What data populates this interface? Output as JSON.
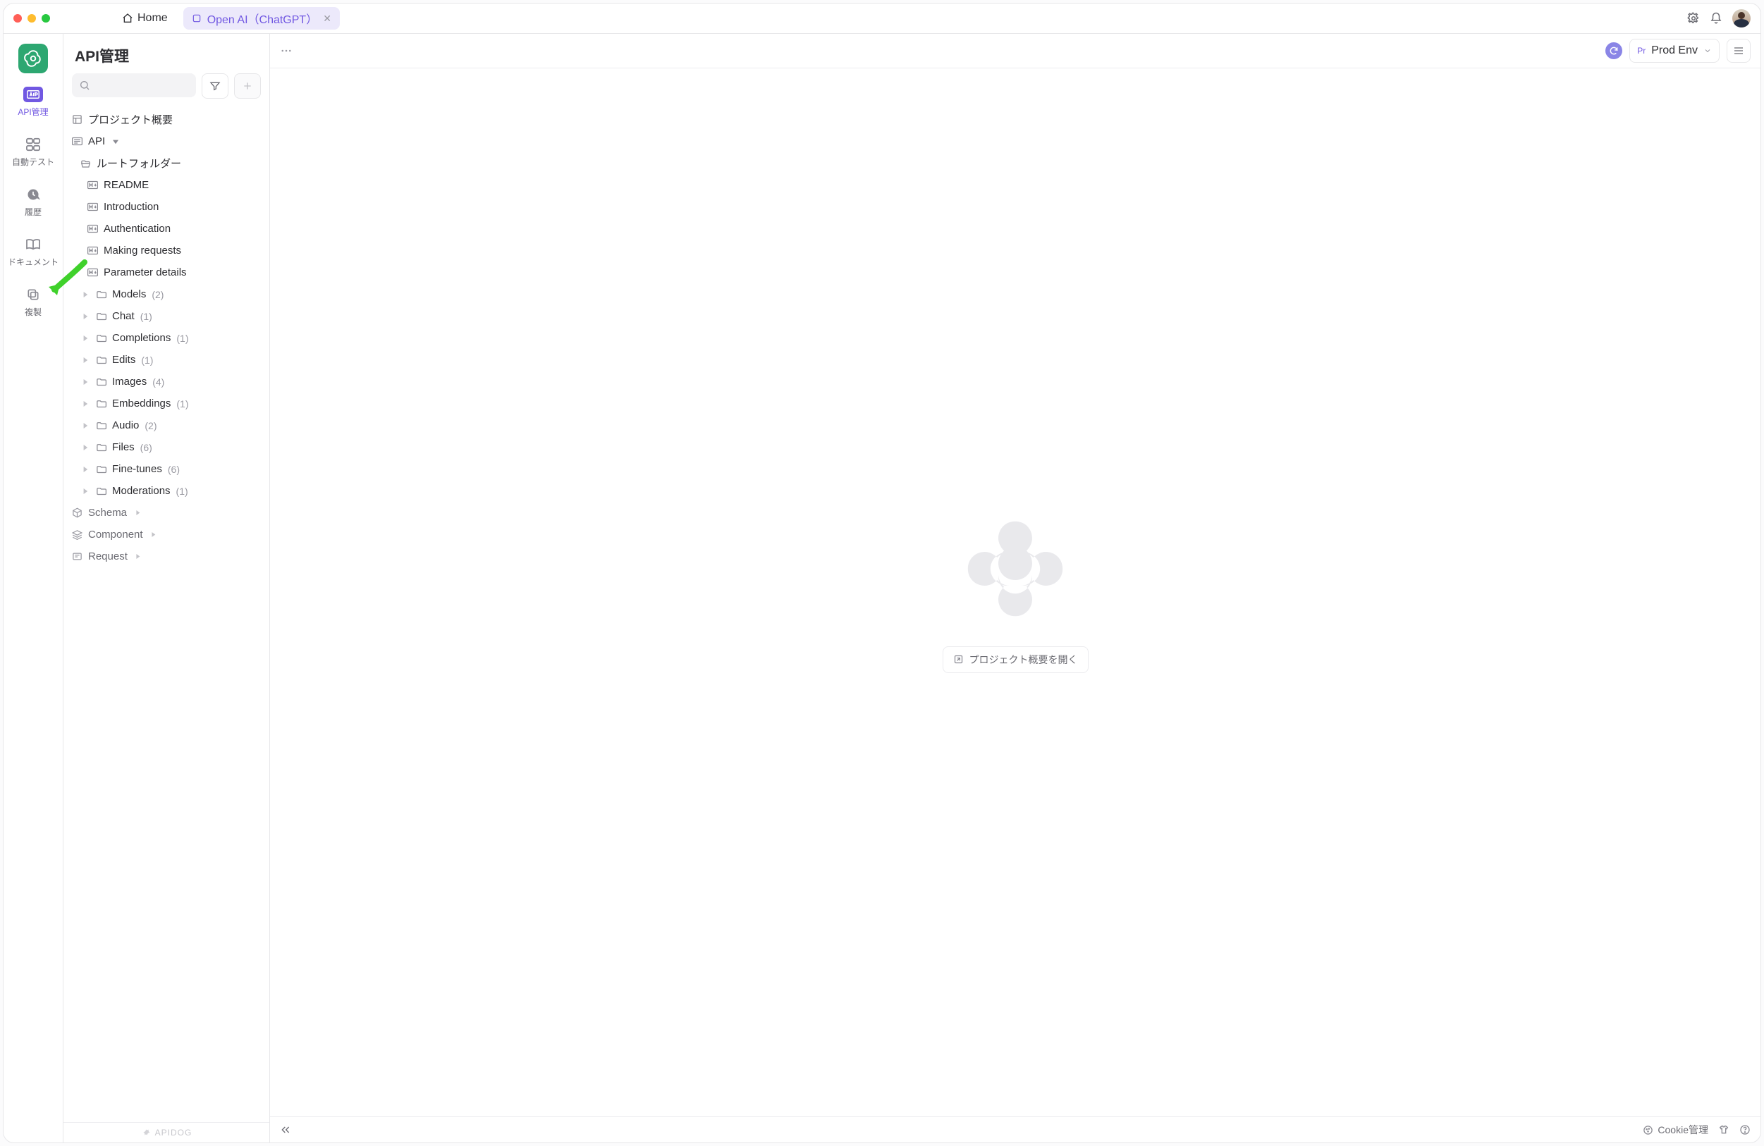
{
  "titlebar": {
    "home_label": "Home",
    "active_tab_label": "Open AI（ChatGPT）"
  },
  "rail": {
    "items": [
      {
        "label": "API管理"
      },
      {
        "label": "自動テスト"
      },
      {
        "label": "履歴"
      },
      {
        "label": "ドキュメント"
      },
      {
        "label": "複製"
      }
    ]
  },
  "sidebar": {
    "title": "API管理",
    "overview_label": "プロジェクト概要",
    "api_root_label": "API",
    "root_folder_label": "ルートフォルダー",
    "docs": [
      {
        "label": "README"
      },
      {
        "label": "Introduction"
      },
      {
        "label": "Authentication"
      },
      {
        "label": "Making requests"
      },
      {
        "label": "Parameter details"
      }
    ],
    "folders": [
      {
        "label": "Models",
        "count": "(2)"
      },
      {
        "label": "Chat",
        "count": "(1)"
      },
      {
        "label": "Completions",
        "count": "(1)"
      },
      {
        "label": "Edits",
        "count": "(1)"
      },
      {
        "label": "Images",
        "count": "(4)"
      },
      {
        "label": "Embeddings",
        "count": "(1)"
      },
      {
        "label": "Audio",
        "count": "(2)"
      },
      {
        "label": "Files",
        "count": "(6)"
      },
      {
        "label": "Fine-tunes",
        "count": "(6)"
      },
      {
        "label": "Moderations",
        "count": "(1)"
      }
    ],
    "sections": [
      {
        "label": "Schema"
      },
      {
        "label": "Component"
      },
      {
        "label": "Request"
      }
    ],
    "footer_brand": "APIDOG"
  },
  "workspace": {
    "env_prefix": "Pr",
    "env_name": "Prod Env",
    "open_overview_label": "プロジェクト概要を開く",
    "cookie_label": "Cookie管理"
  }
}
